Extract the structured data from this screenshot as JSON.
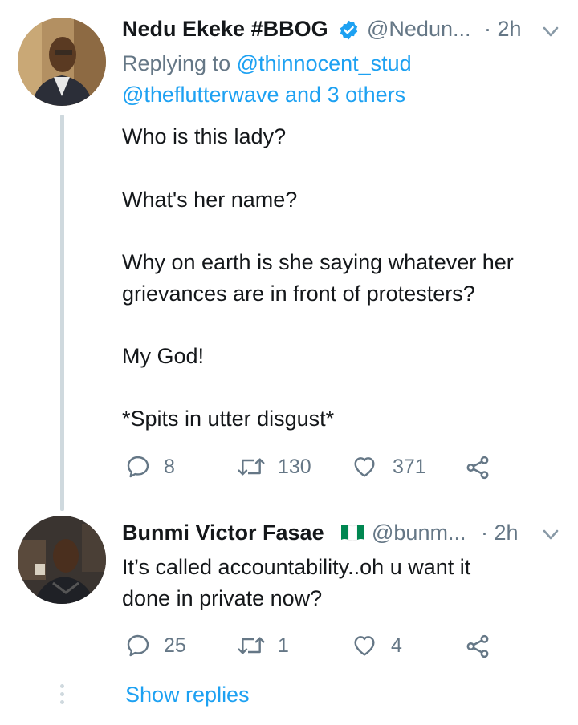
{
  "tweet1": {
    "display_name": "Nedu Ekeke #BBOG",
    "handle": "@Nedun...",
    "time": "· 2h",
    "replying_prefix": "Replying to",
    "reply_user1": "@thinnocent_stud",
    "reply_user2": "@theflutterwave",
    "reply_and": "and",
    "reply_others": "3 others",
    "lines": [
      "Who is this lady?",
      "What's her name?",
      "Why on earth is she saying whatever her",
      "grievances are in front of protesters?",
      "My God!",
      "*Spits in utter disgust*"
    ],
    "reply_count": "8",
    "retweet_count": "130",
    "like_count": "371"
  },
  "tweet2": {
    "display_name": "Bunmi Victor Fasae",
    "handle": "@bunm...",
    "time": "· 2h",
    "lines": [
      "It’s called accountability..oh u want it",
      "done in private now?"
    ],
    "reply_count": "25",
    "retweet_count": "1",
    "like_count": "4"
  },
  "show_replies": "Show replies",
  "colors": {
    "accent": "#1da1f2",
    "muted": "#657786",
    "verified": "#1da1f2",
    "nigeria_green": "#008751"
  }
}
